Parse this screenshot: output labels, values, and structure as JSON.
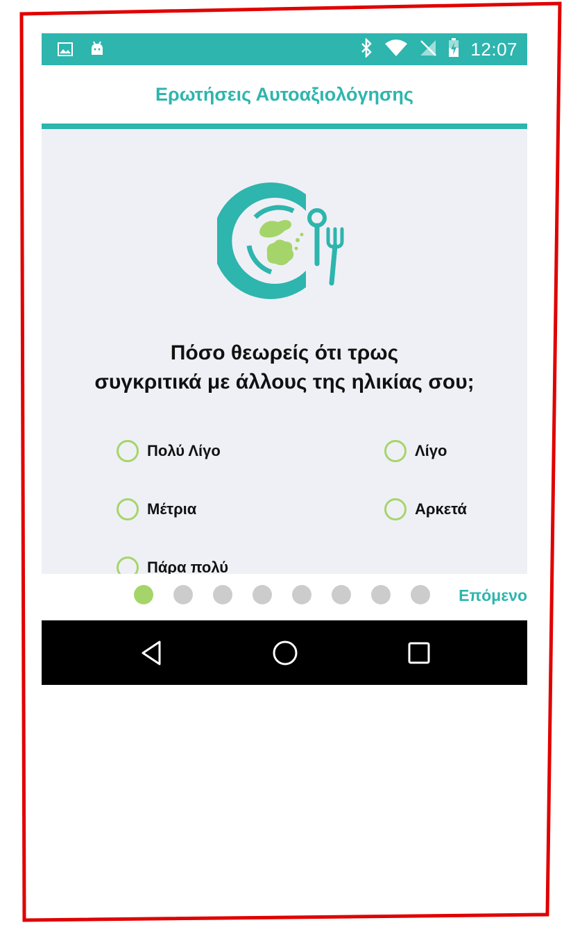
{
  "status_bar": {
    "time": "12:07",
    "icons": [
      "image-icon",
      "android-icon",
      "bluetooth-icon",
      "wifi-icon",
      "no-sim-icon",
      "battery-charging-icon"
    ]
  },
  "app_bar": {
    "title": "Ερωτήσεις Αυτοαξιολόγησης"
  },
  "question": {
    "line1": "Πόσο θεωρείς ότι τρως",
    "line2": "συγκριτικά με άλλους της ηλικίας σου;",
    "icon": "plate-spoon-fork-icon"
  },
  "options": [
    {
      "label": "Πολύ Λίγο",
      "selected": false
    },
    {
      "label": "Λίγο",
      "selected": false
    },
    {
      "label": "Μέτρια",
      "selected": false
    },
    {
      "label": "Αρκετά",
      "selected": false
    },
    {
      "label": "Πάρα πολύ",
      "selected": false
    }
  ],
  "pager": {
    "current_page": 1,
    "total_pages": 8,
    "next_label": "Επόμενο"
  },
  "nav_bar": {
    "buttons": [
      "back-icon",
      "home-icon",
      "recents-icon"
    ]
  },
  "colors": {
    "teal": "#2db5ae",
    "green": "#a5d56a",
    "background": "#eff0f5",
    "frame_red": "#e00000"
  }
}
